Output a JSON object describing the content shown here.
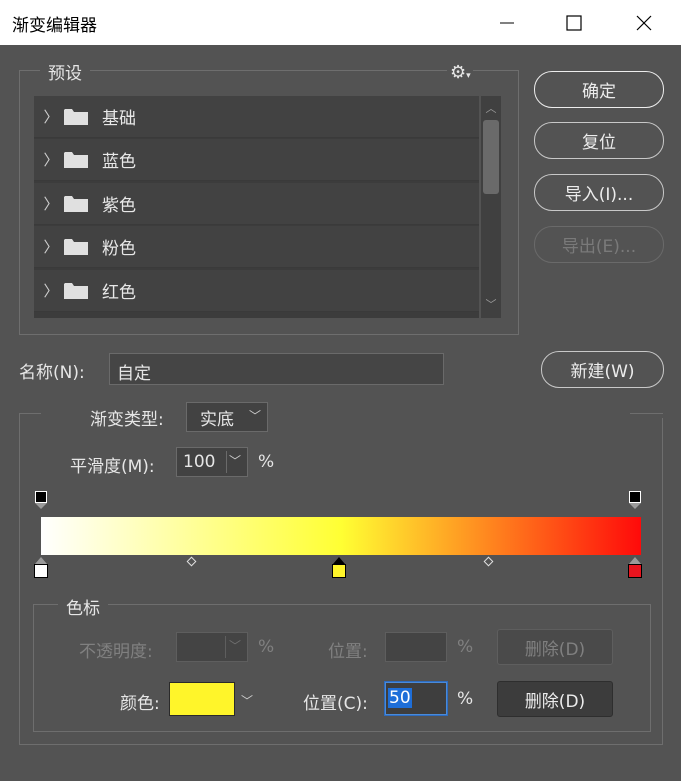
{
  "window": {
    "title": "渐变编辑器",
    "minimize": "minimize",
    "maximize": "maximize",
    "close": "close"
  },
  "presets": {
    "legend": "预设",
    "gear_icon": "gear-icon",
    "items": [
      {
        "label": "基础"
      },
      {
        "label": "蓝色"
      },
      {
        "label": "紫色"
      },
      {
        "label": "粉色"
      },
      {
        "label": "红色"
      }
    ]
  },
  "buttons": {
    "ok": "确定",
    "reset": "复位",
    "import": "导入(I)...",
    "export": "导出(E)...",
    "new": "新建(W)"
  },
  "name": {
    "label": "名称(N):",
    "value": "自定"
  },
  "gradient": {
    "type_label": "渐变类型:",
    "type_value": "实底",
    "smoothness_label": "平滑度(M):",
    "smoothness_value": "100",
    "smoothness_unit": "%",
    "colors": [
      "#ffffff",
      "#ffff33",
      "#ff0a0a"
    ],
    "midpoint_color_location": 50
  },
  "stops": {
    "legend": "色标",
    "opacity_label": "不透明度:",
    "opacity_unit": "%",
    "opacity_location_label": "位置:",
    "opacity_location_unit": "%",
    "opacity_delete": "删除(D)",
    "color_label": "颜色:",
    "color_value": "#fff52a",
    "color_location_label": "位置(C):",
    "color_location_value": "50",
    "color_location_unit": "%",
    "color_delete": "删除(D)"
  }
}
